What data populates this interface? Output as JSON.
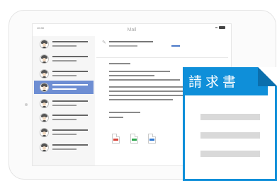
{
  "window": {
    "app_title": "Mail",
    "time": "10:30"
  },
  "mail_list": {
    "item_count": 8,
    "selected_index": 3
  },
  "document": {
    "title": "請求書"
  },
  "colors": {
    "selected": "#6e8ed3",
    "document_blue": "#0f8fd9"
  },
  "icons": [
    "pencil-icon",
    "avatar-icon",
    "file-red-icon",
    "file-green-icon",
    "file-blue-icon",
    "battery-icon"
  ]
}
